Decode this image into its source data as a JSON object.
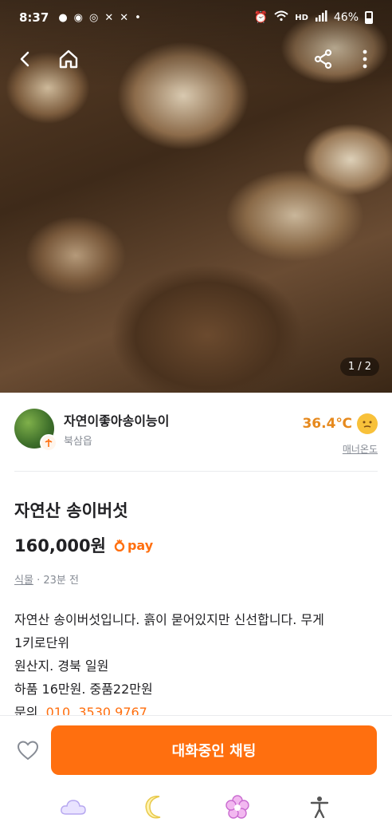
{
  "status_bar": {
    "time": "8:37",
    "battery": "46%",
    "network": "HD"
  },
  "photo": {
    "page_indicator": "1 / 2"
  },
  "seller": {
    "name": "자연이좋아송이능이",
    "location": "북삼읍",
    "temperature": "36.4℃",
    "temperature_label": "매너온도"
  },
  "product": {
    "title": "자연산 송이버섯",
    "price": "160,000원",
    "pay_label": "pay",
    "category": "식물",
    "time_ago": "· 23분 전",
    "description_lines": [
      "자연산 송이버섯입니다. 흙이 묻어있지만 신선합니다.  무게",
      "1키로단위",
      "원산지. 경북 일원",
      "하품 16만원. 중품22만원"
    ],
    "inquiry_label": "문의. ",
    "inquiry_phone": "010. 3530 9767"
  },
  "bottom_bar": {
    "chat_button_label": "대화중인 채팅"
  },
  "colors": {
    "accent": "#ff6f0f",
    "temperature": "#e6891d"
  },
  "icons": {
    "back": "back-arrow-icon",
    "home": "home-icon",
    "share": "share-icon",
    "more": "more-vertical-icon",
    "heart": "heart-icon"
  }
}
